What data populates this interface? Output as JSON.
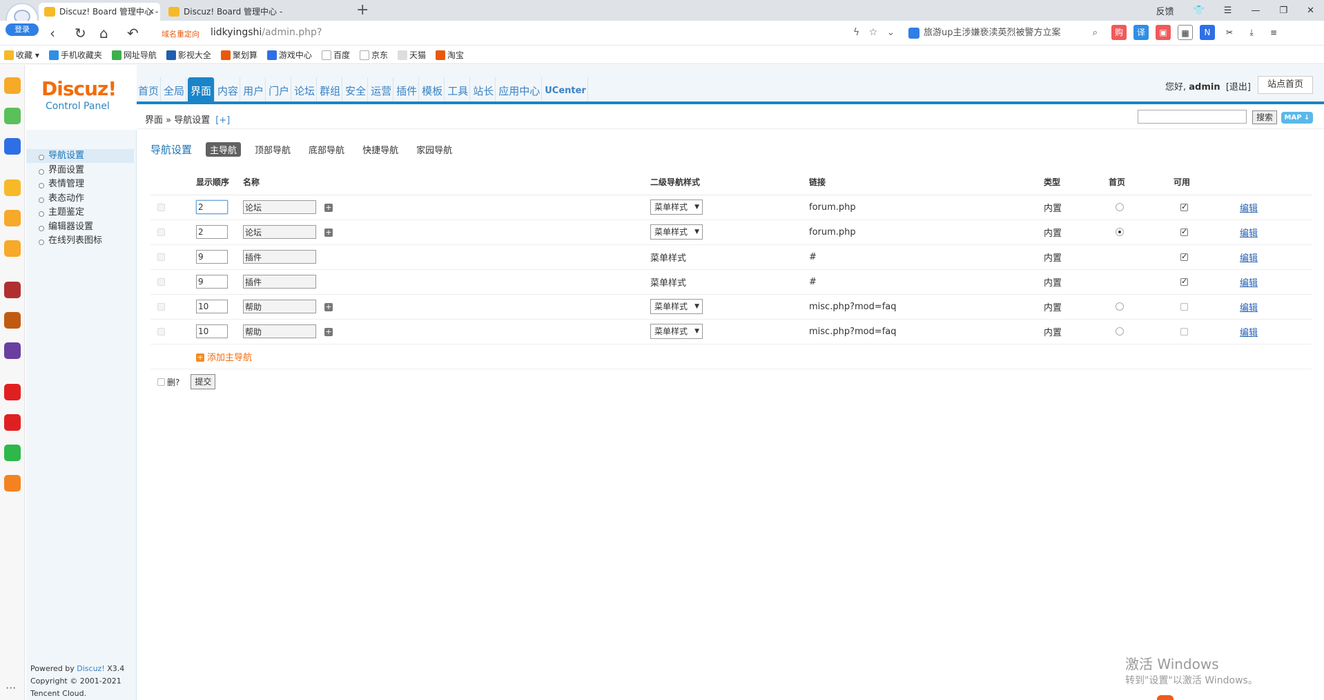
{
  "browser": {
    "login_label": "登录",
    "tabs": [
      {
        "title": "Discuz! Board 管理中心 - 界",
        "active": true
      },
      {
        "title": "Discuz! Board 管理中心 - 界",
        "active": false
      }
    ],
    "window": {
      "feedback": "反馈"
    },
    "redirect_label": "域名重定向",
    "url_host": "lidkyingshi",
    "url_path": "/admin.php?",
    "search_text": "旅游up主涉嫌亵渎英烈被警方立案",
    "bookmarks": [
      "收藏",
      "手机收藏夹",
      "网址导航",
      "影视大全",
      "聚划算",
      "游戏中心",
      "百度",
      "京东",
      "天猫",
      "淘宝"
    ]
  },
  "admin": {
    "logo_text": "Discuz!",
    "logo_sub": "Control Panel",
    "topnav": [
      "首页",
      "全局",
      "界面",
      "内容",
      "用户",
      "门户",
      "论坛",
      "群组",
      "安全",
      "运营",
      "插件",
      "模板",
      "工具",
      "站长",
      "应用中心",
      "UCenter"
    ],
    "topnav_active": 2,
    "greeting_prefix": "您好, ",
    "username": "admin",
    "logout": "[退出]",
    "site_home": "站点首页",
    "breadcrumb": "界面 » 导航设置",
    "breadcrumb_plus": "[+]",
    "search_button": "搜索",
    "map_button": "MAP ↓",
    "leftmenu": [
      "导航设置",
      "界面设置",
      "表情管理",
      "表态动作",
      "主题鉴定",
      "编辑器设置",
      "在线列表图标"
    ],
    "leftmenu_active": 0,
    "powered": {
      "line1_prefix": "Powered by ",
      "line1_brand": "Discuz!",
      "line1_version": " X3.4",
      "line2": "Copyright © 2001-2021",
      "line3": "Tencent Cloud."
    }
  },
  "content": {
    "section_title": "导航设置",
    "subtabs": [
      "主导航",
      "顶部导航",
      "底部导航",
      "快捷导航",
      "家园导航"
    ],
    "subtab_active": 0,
    "columns": {
      "order": "显示顺序",
      "name": "名称",
      "sub_style": "二级导航样式",
      "link": "链接",
      "type": "类型",
      "home": "首页",
      "enabled": "可用"
    },
    "rows": [
      {
        "order": "2",
        "name": "论坛",
        "style": "菜单样式",
        "style_select": true,
        "link": "forum.php",
        "type": "内置",
        "home": false,
        "has_home_radio": true,
        "enabled": true,
        "edit": "编辑"
      },
      {
        "order": "2",
        "name": "论坛",
        "style": "菜单样式",
        "style_select": true,
        "link": "forum.php",
        "type": "内置",
        "home": true,
        "has_home_radio": true,
        "enabled": true,
        "edit": "编辑"
      },
      {
        "order": "9",
        "name": "插件",
        "style": "菜单样式",
        "style_select": false,
        "link": "#",
        "type": "内置",
        "home": false,
        "has_home_radio": false,
        "enabled": true,
        "edit": "编辑"
      },
      {
        "order": "9",
        "name": "插件",
        "style": "菜单样式",
        "style_select": false,
        "link": "#",
        "type": "内置",
        "home": false,
        "has_home_radio": false,
        "enabled": true,
        "edit": "编辑"
      },
      {
        "order": "10",
        "name": "帮助",
        "style": "菜单样式",
        "style_select": true,
        "link": "misc.php?mod=faq",
        "type": "内置",
        "home": false,
        "has_home_radio": true,
        "enabled": false,
        "edit": "编辑"
      },
      {
        "order": "10",
        "name": "帮助",
        "style": "菜单样式",
        "style_select": true,
        "link": "misc.php?mod=faq",
        "type": "内置",
        "home": false,
        "has_home_radio": true,
        "enabled": false,
        "edit": "编辑"
      }
    ],
    "add_main_nav": "添加主导航",
    "delete_label": "删?",
    "submit_label": "提交"
  },
  "watermark": {
    "line1": "激活 Windows",
    "line2": "转到\"设置\"以激活 Windows。"
  }
}
